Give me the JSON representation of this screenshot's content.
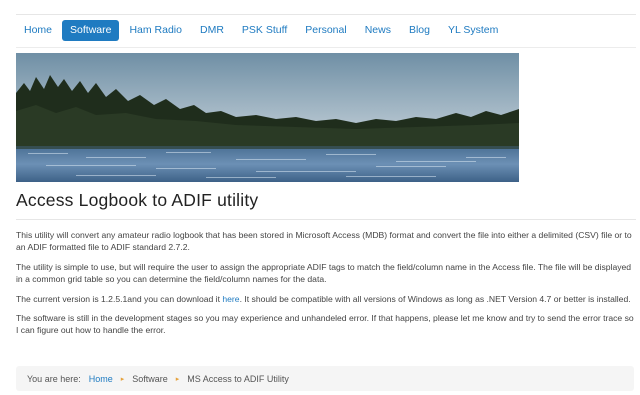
{
  "nav": {
    "items": [
      {
        "label": "Home"
      },
      {
        "label": "Software",
        "active": true
      },
      {
        "label": "Ham Radio"
      },
      {
        "label": "DMR"
      },
      {
        "label": "PSK Stuff"
      },
      {
        "label": "Personal"
      },
      {
        "label": "News"
      },
      {
        "label": "Blog"
      },
      {
        "label": "YL System"
      }
    ]
  },
  "page": {
    "title": "Access Logbook to ADIF utility",
    "p1": "This utility will convert any amateur radio logbook that has been stored in Microsoft Access (MDB) format and convert the file into either a delimited (CSV) file or to an ADIF formatted file to ADIF standard 2.7.2.",
    "p2": "The utility is simple to use, but will require the user to assign the appropriate ADIF tags to match the field/column name in the Access file.  The file will be displayed in a common grid table so you can determine the field/column names for the data.",
    "p3_before": "The current version is 1.2.5.1and you can download it ",
    "p3_link": "here",
    "p3_after": ".  It should be compatible with all versions of Windows as long as .NET Version 4.7 or better is installed.",
    "p4": "The software is still in the development stages so you may experience and unhandeled error.  If that happens, please let me know and try to send the error trace so I can figure out how to handle the error."
  },
  "breadcrumb": {
    "label": "You are here:",
    "items": [
      "Home",
      "Software",
      "MS Access to ADIF Utility"
    ],
    "separator": "▸"
  },
  "colors": {
    "accent": "#1f7bc1",
    "separator": "#e6a23c"
  }
}
